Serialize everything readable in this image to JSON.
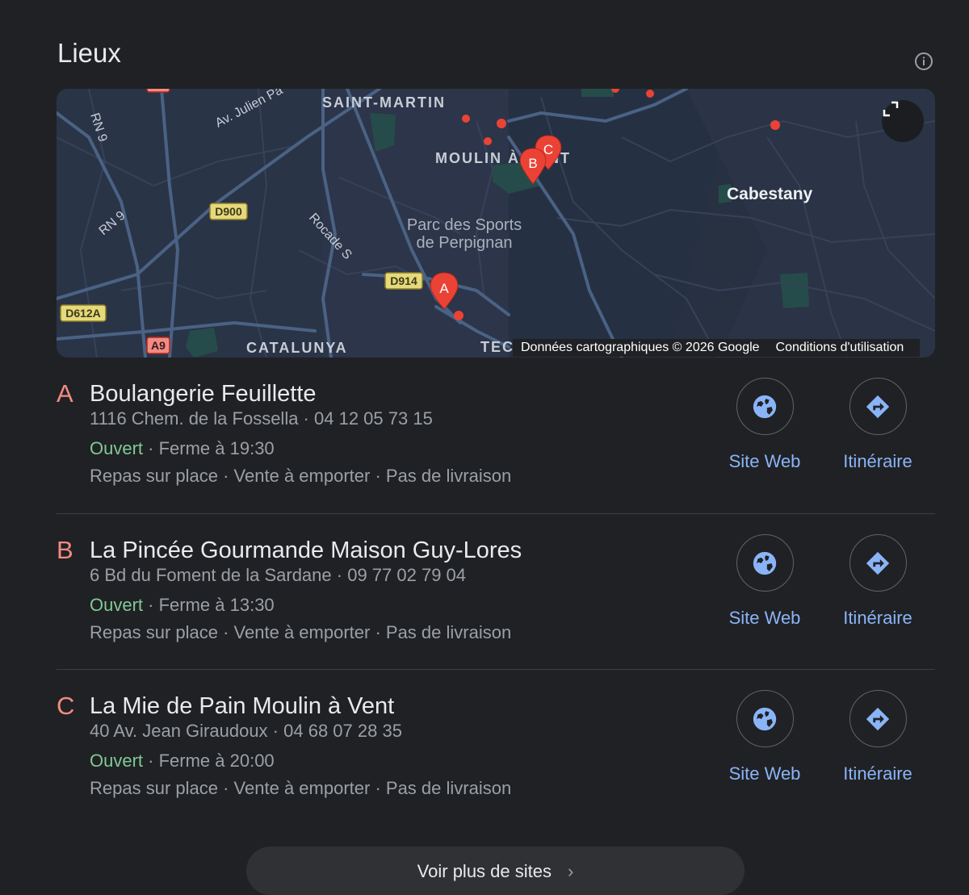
{
  "section": {
    "title": "Lieux",
    "info_icon": "info-icon"
  },
  "map": {
    "labels": {
      "saint_martin": "SAINT-MARTIN",
      "moulin": "MOULIN À VENT",
      "cabestany": "Cabestany",
      "parc_line1": "Parc des Sports",
      "parc_line2": "de Perpignan",
      "catalunya": "CATALUNYA",
      "av_julien": "Av. Julien Pa",
      "rocade": "Rocade S",
      "rn9_top": "RN 9",
      "rn9_mid": "RN 9",
      "d900": "D900",
      "d914": "D914",
      "d612a": "D612A",
      "a9": "A9",
      "tec": "TECNOSUD"
    },
    "markers": [
      "A",
      "B",
      "C"
    ],
    "copyright": "Données cartographiques © 2026 Google",
    "terms": "Conditions d'utilisation",
    "expand_icon": "expand-icon"
  },
  "places": [
    {
      "letter": "A",
      "name": "Boulangerie Feuillette",
      "address": "1116 Chem. de la Fossella",
      "phone": "04 12 05 73 15",
      "status": "Ouvert",
      "hours": "Ferme à 19:30",
      "opt1": "Repas sur place",
      "opt2": "Vente à emporter",
      "opt3": "Pas de livraison",
      "website_label": "Site Web",
      "directions_label": "Itinéraire"
    },
    {
      "letter": "B",
      "name": "La Pincée Gourmande Maison Guy-Lores",
      "address": "6 Bd du Foment de la Sardane",
      "phone": "09 77 02 79 04",
      "status": "Ouvert",
      "hours": "Ferme à 13:30",
      "opt1": "Repas sur place",
      "opt2": "Vente à emporter",
      "opt3": "Pas de livraison",
      "website_label": "Site Web",
      "directions_label": "Itinéraire"
    },
    {
      "letter": "C",
      "name": "La Mie de Pain Moulin à Vent",
      "address": "40 Av. Jean Giraudoux",
      "phone": "04 68 07 28 35",
      "status": "Ouvert",
      "hours": "Ferme à 20:00",
      "opt1": "Repas sur place",
      "opt2": "Vente à emporter",
      "opt3": "Pas de livraison",
      "website_label": "Site Web",
      "directions_label": "Itinéraire"
    }
  ],
  "more_button": {
    "label": "Voir plus de sites",
    "icon": "chevron-right-icon"
  },
  "colors": {
    "background": "#202124",
    "marker": "#ea4335",
    "open": "#81c995",
    "letter": "#f28b82",
    "link": "#8ab4f8"
  }
}
